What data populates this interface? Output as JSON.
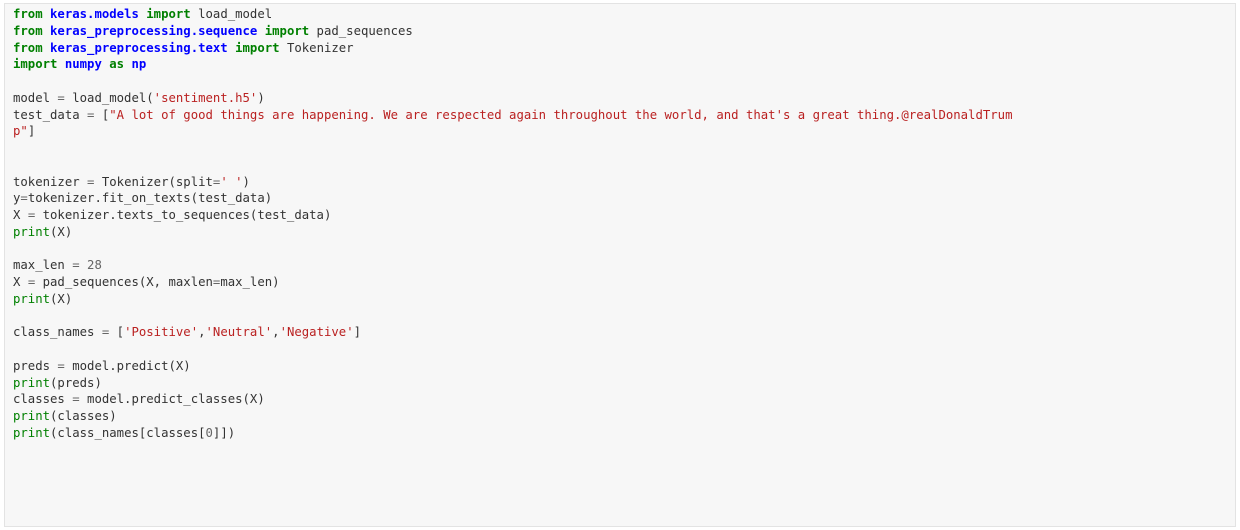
{
  "editor": {
    "lines": [
      [
        [
          "kw",
          "from"
        ],
        [
          "tx",
          " "
        ],
        [
          "mod",
          "keras.models"
        ],
        [
          "tx",
          " "
        ],
        [
          "kw",
          "import"
        ],
        [
          "tx",
          " load_model"
        ]
      ],
      [
        [
          "kw",
          "from"
        ],
        [
          "tx",
          " "
        ],
        [
          "mod",
          "keras_preprocessing.sequence"
        ],
        [
          "tx",
          " "
        ],
        [
          "kw",
          "import"
        ],
        [
          "tx",
          " pad_sequences"
        ]
      ],
      [
        [
          "kw",
          "from"
        ],
        [
          "tx",
          " "
        ],
        [
          "mod",
          "keras_preprocessing.text"
        ],
        [
          "tx",
          " "
        ],
        [
          "kw",
          "import"
        ],
        [
          "tx",
          " Tokenizer"
        ]
      ],
      [
        [
          "kw",
          "import"
        ],
        [
          "tx",
          " "
        ],
        [
          "mod",
          "numpy"
        ],
        [
          "tx",
          " "
        ],
        [
          "kw",
          "as"
        ],
        [
          "tx",
          " "
        ],
        [
          "mod",
          "np"
        ]
      ],
      [],
      [
        [
          "tx",
          "model "
        ],
        [
          "op",
          "="
        ],
        [
          "tx",
          " load_model("
        ],
        [
          "str",
          "'sentiment.h5'"
        ],
        [
          "tx",
          ")"
        ]
      ],
      [
        [
          "tx",
          "test_data "
        ],
        [
          "op",
          "="
        ],
        [
          "tx",
          " ["
        ],
        [
          "str",
          "\"A lot of good things are happening. We are respected again throughout the world, and that's a great thing.@realDonaldTrum"
        ]
      ],
      [
        [
          "str",
          "p\""
        ],
        [
          "tx",
          "]"
        ]
      ],
      [],
      [],
      [
        [
          "tx",
          "tokenizer "
        ],
        [
          "op",
          "="
        ],
        [
          "tx",
          " Tokenizer(split"
        ],
        [
          "op",
          "="
        ],
        [
          "str",
          "' '"
        ],
        [
          "tx",
          ")"
        ]
      ],
      [
        [
          "tx",
          "y"
        ],
        [
          "op",
          "="
        ],
        [
          "tx",
          "tokenizer.fit_on_texts(test_data)"
        ]
      ],
      [
        [
          "tx",
          "X "
        ],
        [
          "op",
          "="
        ],
        [
          "tx",
          " tokenizer.texts_to_sequences(test_data)"
        ]
      ],
      [
        [
          "bi",
          "print"
        ],
        [
          "tx",
          "(X)"
        ]
      ],
      [],
      [
        [
          "tx",
          "max_len "
        ],
        [
          "op",
          "="
        ],
        [
          "tx",
          " "
        ],
        [
          "num",
          "28"
        ]
      ],
      [
        [
          "tx",
          "X "
        ],
        [
          "op",
          "="
        ],
        [
          "tx",
          " pad_sequences(X, maxlen"
        ],
        [
          "op",
          "="
        ],
        [
          "tx",
          "max_len)"
        ]
      ],
      [
        [
          "bi",
          "print"
        ],
        [
          "tx",
          "(X)"
        ]
      ],
      [],
      [
        [
          "tx",
          "class_names "
        ],
        [
          "op",
          "="
        ],
        [
          "tx",
          " ["
        ],
        [
          "str",
          "'Positive'"
        ],
        [
          "tx",
          ","
        ],
        [
          "str",
          "'Neutral'"
        ],
        [
          "tx",
          ","
        ],
        [
          "str",
          "'Negative'"
        ],
        [
          "tx",
          "]"
        ]
      ],
      [],
      [
        [
          "tx",
          "preds "
        ],
        [
          "op",
          "="
        ],
        [
          "tx",
          " model.predict(X)"
        ]
      ],
      [
        [
          "bi",
          "print"
        ],
        [
          "tx",
          "(preds)"
        ]
      ],
      [
        [
          "tx",
          "classes "
        ],
        [
          "op",
          "="
        ],
        [
          "tx",
          " model.predict_classes(X)"
        ]
      ],
      [
        [
          "bi",
          "print"
        ],
        [
          "tx",
          "(classes)"
        ]
      ],
      [
        [
          "bi",
          "print"
        ],
        [
          "tx",
          "(class_names[classes["
        ],
        [
          "num",
          "0"
        ],
        [
          "tx",
          "]])"
        ]
      ]
    ]
  }
}
